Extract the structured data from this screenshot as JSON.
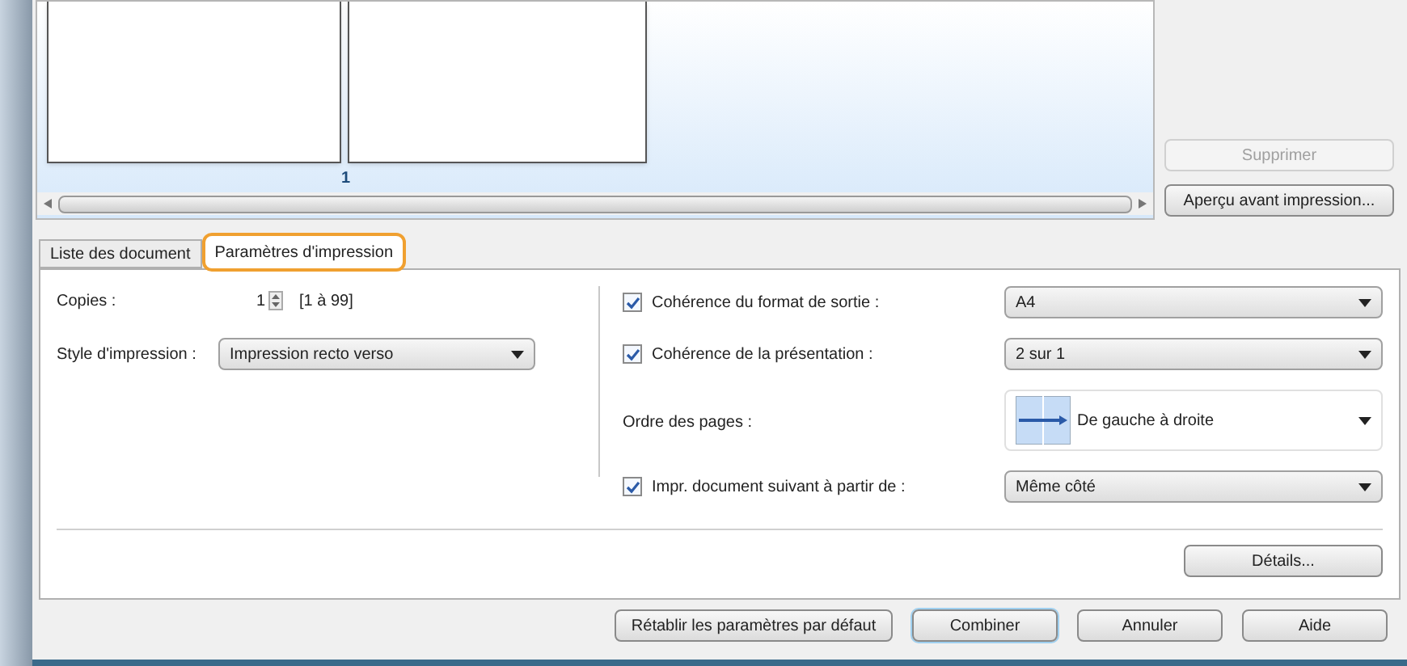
{
  "preview": {
    "page_number": "1"
  },
  "side_buttons": [
    {
      "label": "Supprimer",
      "disabled": true
    },
    {
      "label": "Aperçu avant impression...",
      "disabled": false
    }
  ],
  "tabs": [
    {
      "label": "Liste des document",
      "selected": false
    },
    {
      "label": "Paramètres d'impression",
      "selected": true
    }
  ],
  "copies": {
    "label": "Copies :",
    "value": "1",
    "range": "[1 à 99]"
  },
  "style": {
    "label": "Style d'impression :",
    "value": "Impression recto verso"
  },
  "options": [
    {
      "kind": "check",
      "label": "Cohérence du format de sortie :",
      "checked": true,
      "value": "A4"
    },
    {
      "kind": "check",
      "label": "Cohérence de la présentation :",
      "checked": true,
      "value": "2 sur 1"
    },
    {
      "kind": "order",
      "label": "Ordre des pages :",
      "value": "De gauche à droite"
    },
    {
      "kind": "check",
      "label": "Impr. document suivant à partir de :",
      "checked": true,
      "value": "Même côté"
    }
  ],
  "details_button": "Détails...",
  "footer_buttons": [
    {
      "label": "Rétablir les paramètres par défaut",
      "default": false
    },
    {
      "label": "Combiner",
      "default": true
    },
    {
      "label": "Annuler",
      "default": false
    },
    {
      "label": "Aide",
      "default": false
    }
  ]
}
